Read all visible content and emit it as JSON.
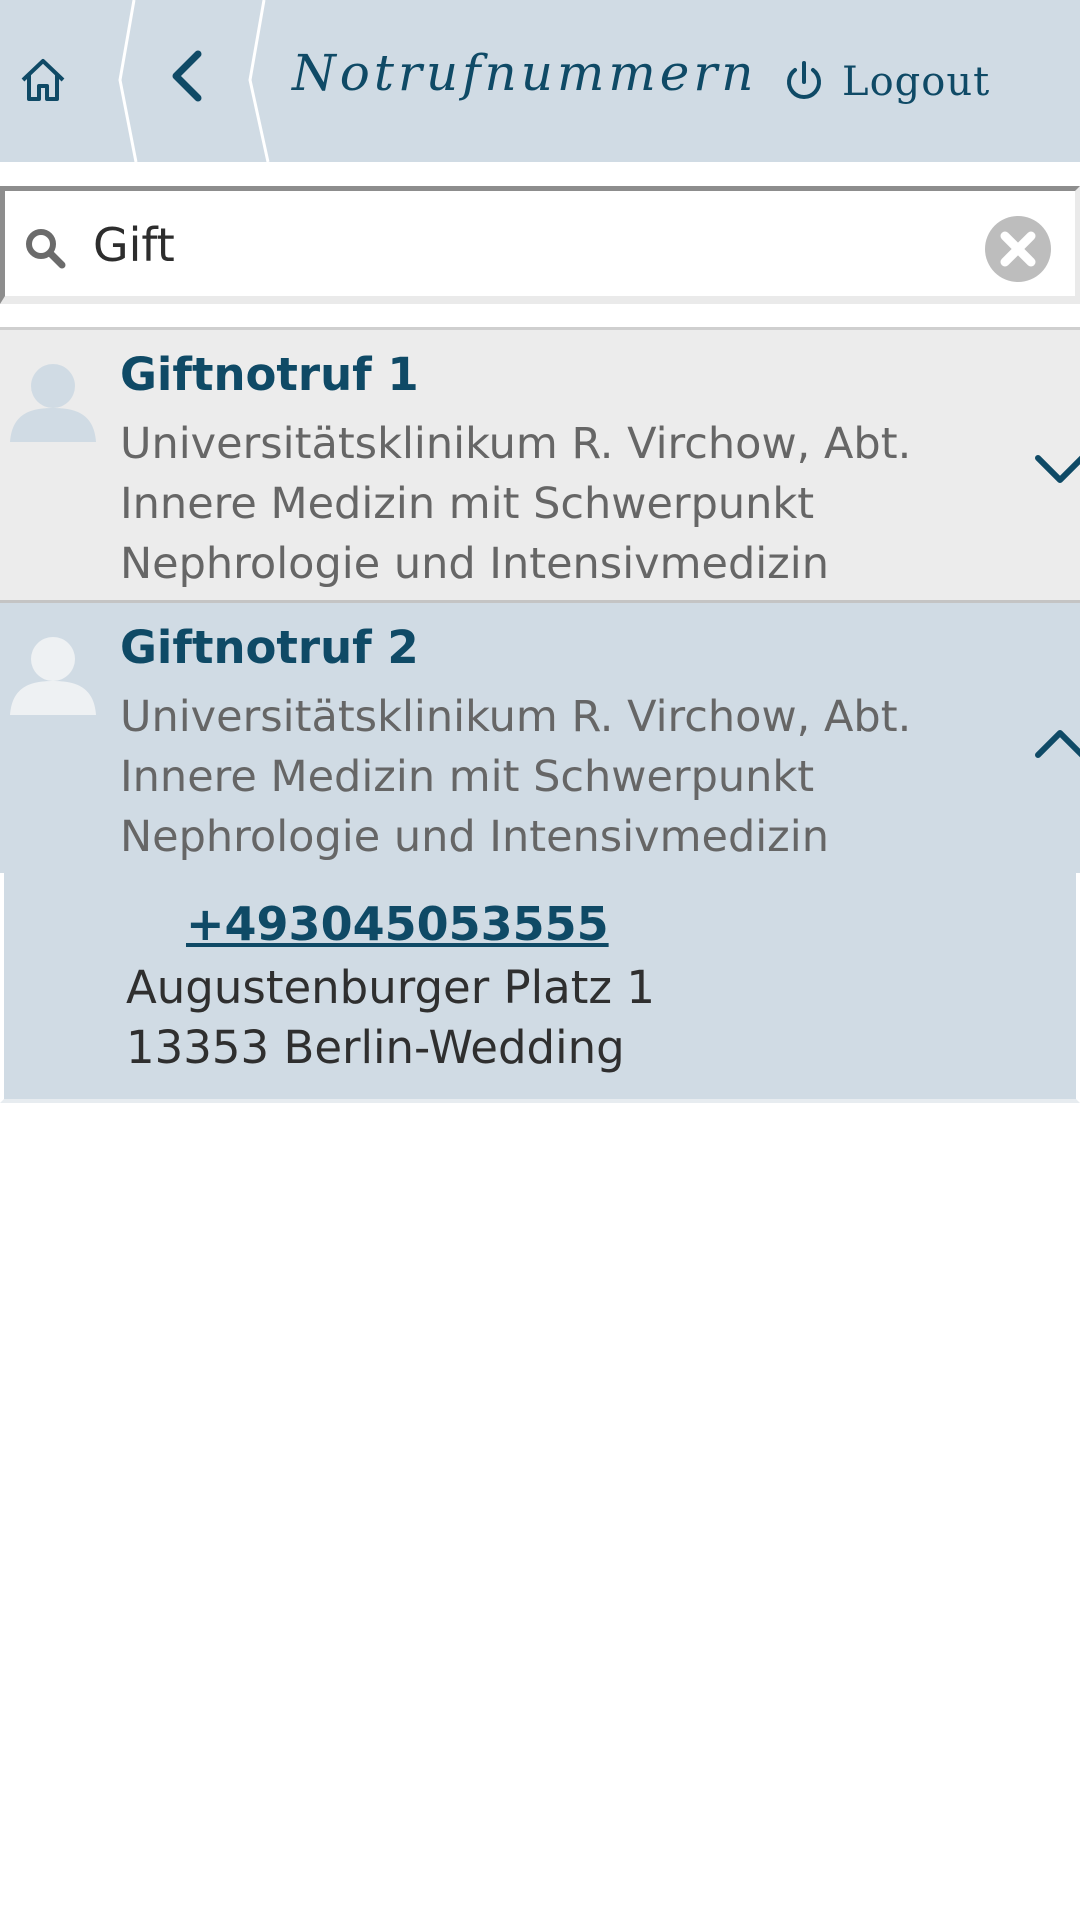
{
  "header": {
    "title": "Notrufnummern",
    "logout_label": "Logout",
    "home_icon": "home-icon",
    "back_icon": "chevron-left-icon",
    "power_icon": "power-icon"
  },
  "search": {
    "value": "Gift",
    "placeholder": ""
  },
  "results": [
    {
      "title": "Giftnotruf 1",
      "desc_lines": [
        "Universitätsklinikum R. Virchow, Abt.",
        "Innere Medizin mit Schwerpunkt",
        "Nephrologie und Intensivmedizin"
      ],
      "expanded": false
    },
    {
      "title": "Giftnotruf 2",
      "desc_lines": [
        "Universitätsklinikum R. Virchow, Abt.",
        "Innere Medizin mit Schwerpunkt",
        "Nephrologie und Intensivmedizin"
      ],
      "expanded": true,
      "details": {
        "phone": "+493045053555",
        "street": "Augustenburger Platz 1",
        "city": "13353 Berlin-Wedding"
      }
    }
  ],
  "colors": {
    "accent": "#0f4a66",
    "header_bg": "#d0dbe4",
    "collapsed_bg": "#ececec",
    "expanded_bg": "#d0dbe4"
  }
}
